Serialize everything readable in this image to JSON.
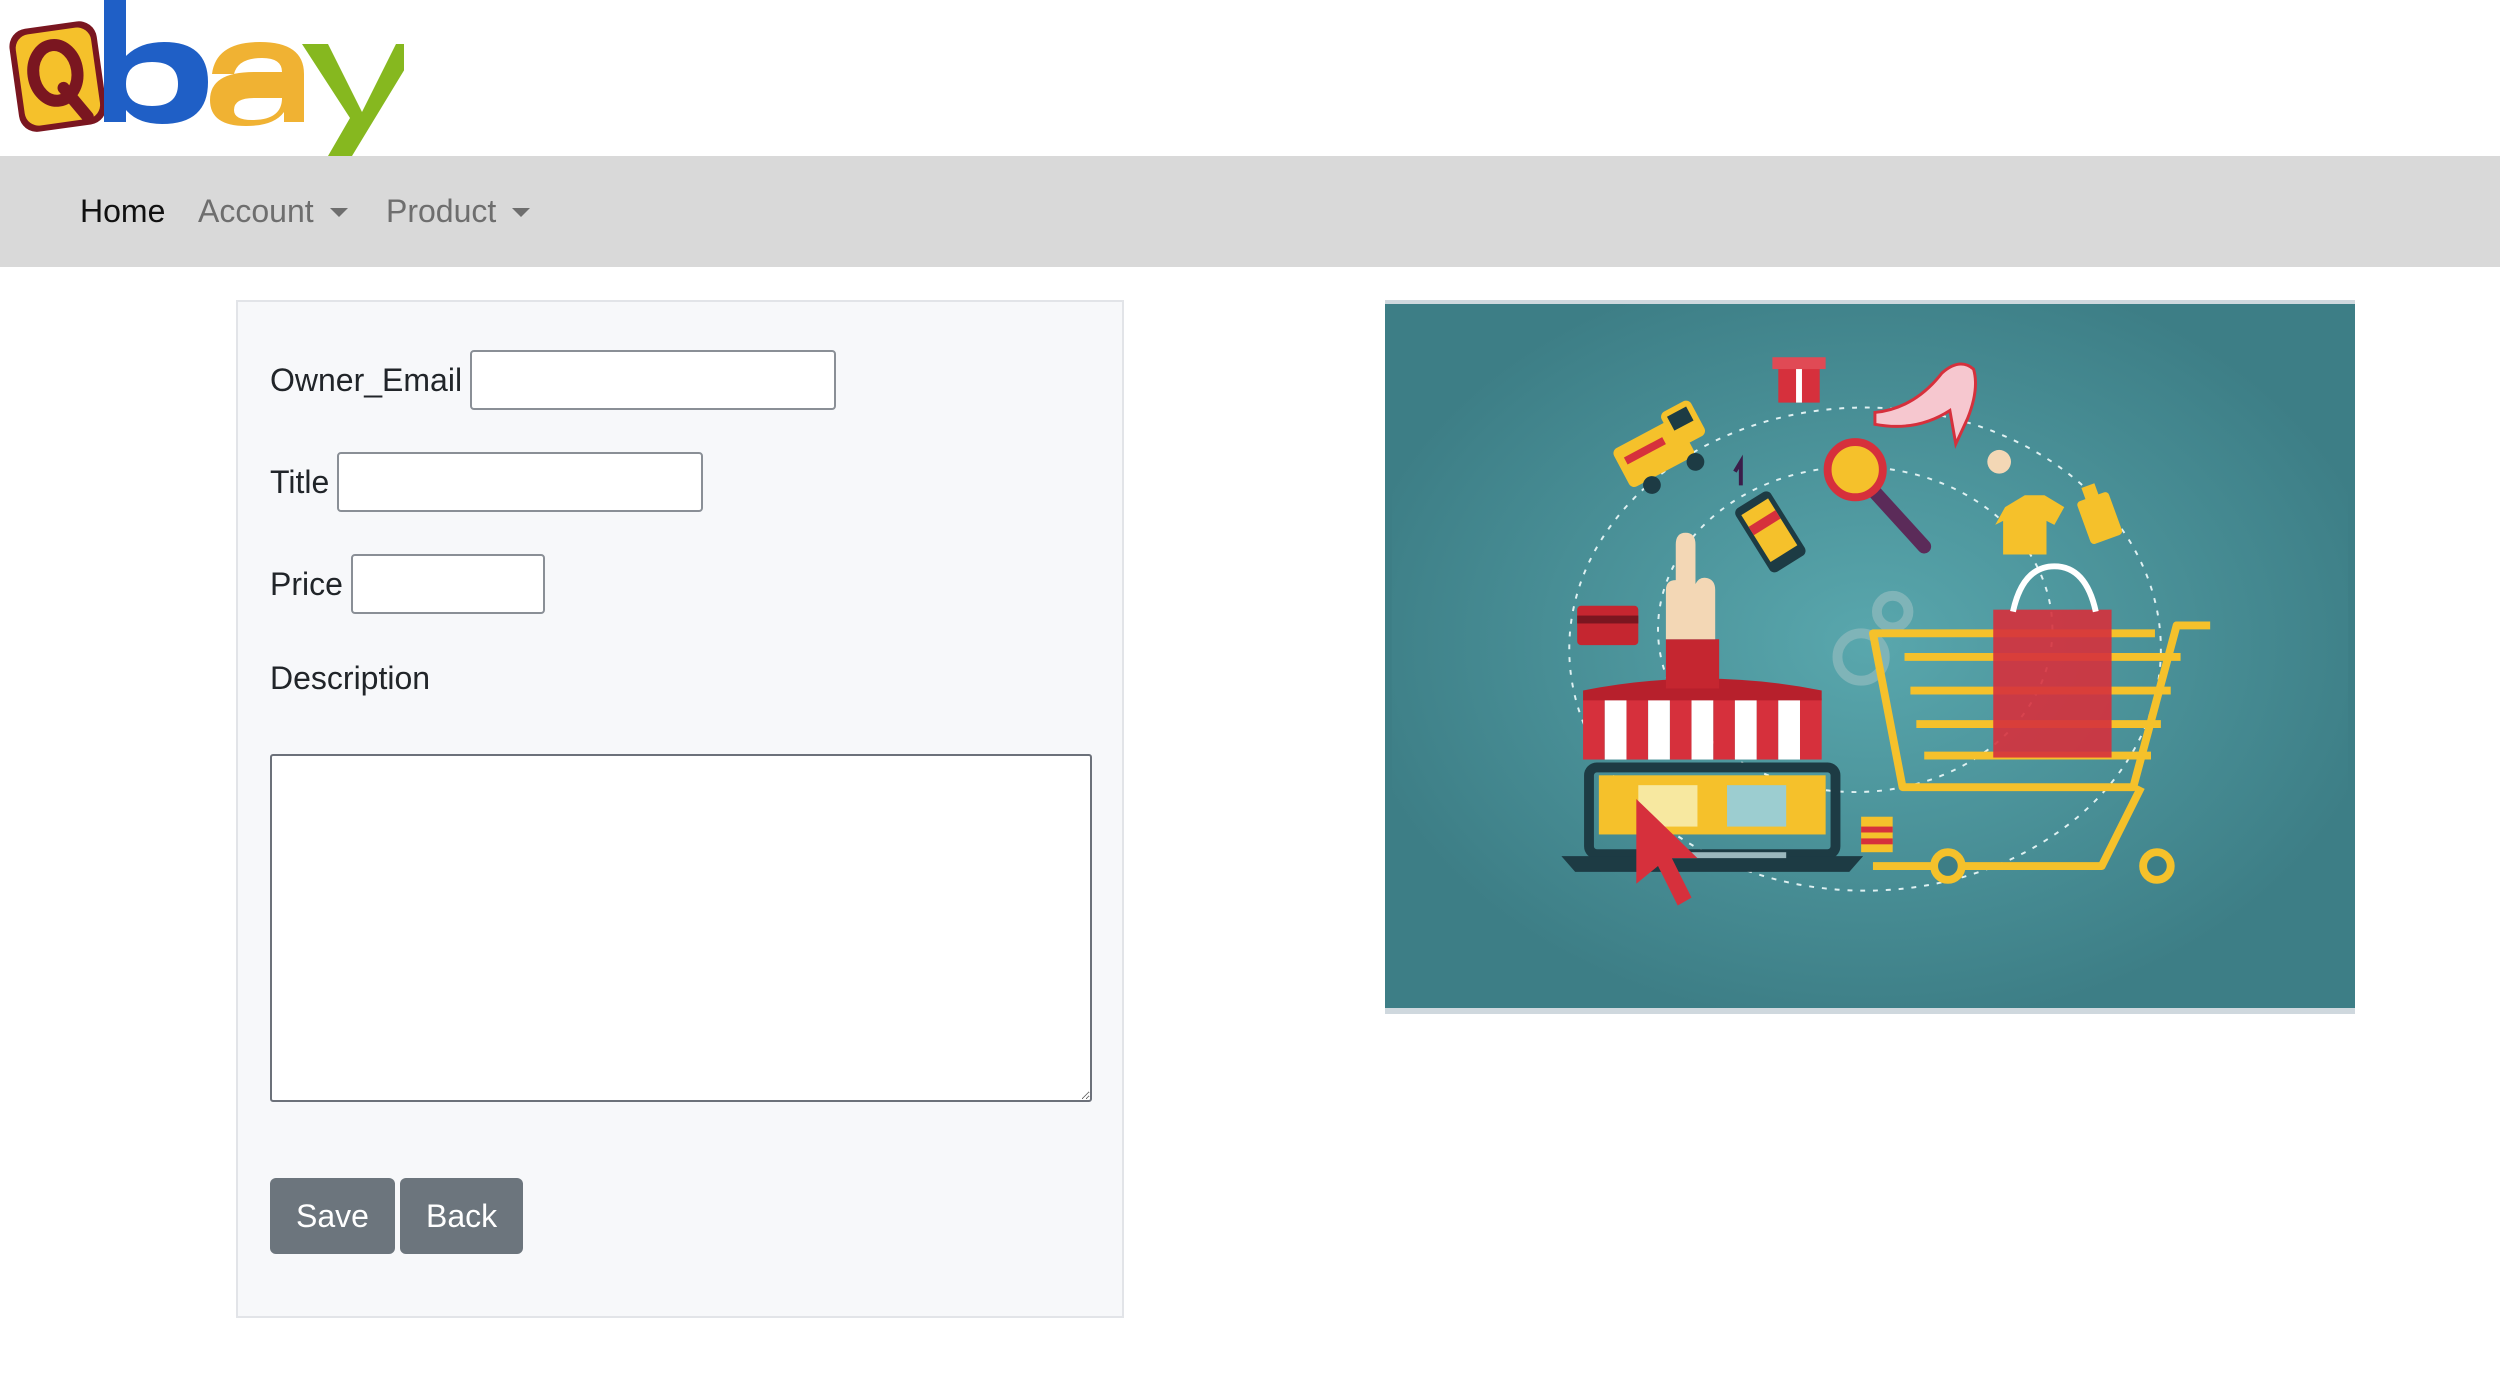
{
  "brand": {
    "logo_letters": [
      "q",
      "b",
      "a",
      "y"
    ],
    "colors": {
      "q": "#f5c12b",
      "b": "#1f5fc6",
      "a": "#f0b233",
      "y": "#86b81f"
    }
  },
  "navbar": {
    "items": [
      {
        "label": "Home",
        "active": true,
        "dropdown": false
      },
      {
        "label": "Account",
        "active": false,
        "dropdown": true
      },
      {
        "label": "Product",
        "active": false,
        "dropdown": true
      }
    ]
  },
  "form": {
    "owner_email_label": "Owner_Email",
    "owner_email_value": "",
    "title_label": "Title",
    "title_value": "",
    "price_label": "Price",
    "price_value": "",
    "description_label": "Description",
    "description_value": "",
    "save_label": "Save",
    "back_label": "Back"
  },
  "illustration": {
    "background": "#3d7e86",
    "icons": [
      "storefront-icon",
      "laptop-icon",
      "shopping-cart-icon",
      "shopping-bag-icon",
      "magnifier-icon",
      "gear-icon",
      "delivery-truck-icon",
      "gift-icon",
      "high-heel-icon",
      "credit-card-icon",
      "smartphone-icon",
      "pointer-hand-icon",
      "cursor-icon"
    ]
  }
}
